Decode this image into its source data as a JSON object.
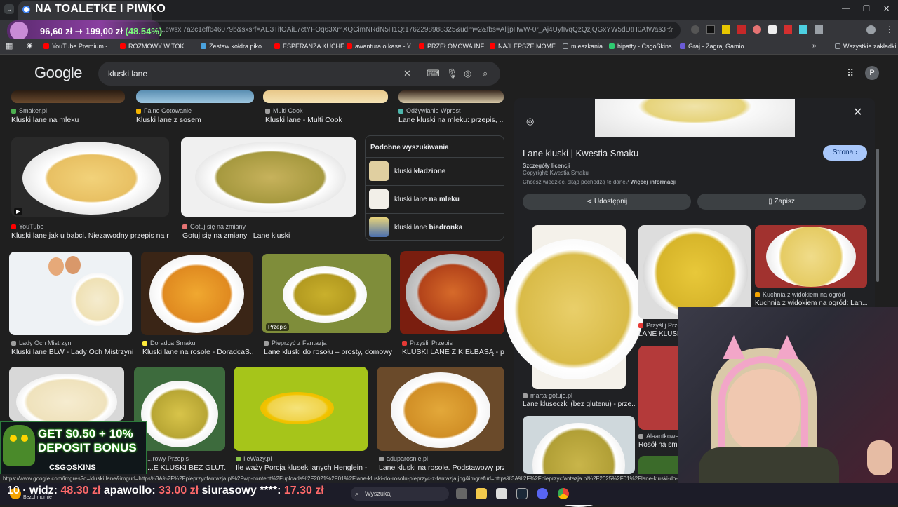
{
  "overlay": {
    "stream_title": "NA TOALETKE I PIWKO",
    "donation_amount": "96,60 zł ➝ 199,00 zł",
    "donation_pct": "(48.54%)"
  },
  "browser": {
    "url": "..ewsxl7a2c1eff646079b&sxsrf=AE3TifOAiL7ctYFOq63XmXQCimNRdN5H1Q:1762298988325&udm=2&fbs=AlljpHwW-0r_Aj4UyfIvqQzQzjQGxYW5dDtH0AfWas3lK4rdHx1nh...",
    "bookmarks": [
      {
        "label": "YouTube Premium -...",
        "color": "#ff0000"
      },
      {
        "label": "ROZMOWY W TOK...",
        "color": "#ff0000"
      },
      {
        "label": "Zestaw kołdra piko...",
        "color": "#4aa3df"
      },
      {
        "label": "ESPERANZA KUCHE...",
        "color": "#ff0000"
      },
      {
        "label": "awantura o kase - Y...",
        "color": "#ff0000"
      },
      {
        "label": "PRZEŁOMOWA INF...",
        "color": "#ff0000"
      },
      {
        "label": "NAJLEPSZE MOME...",
        "color": "#ff0000"
      },
      {
        "label": "mieszkania",
        "color": "#9aa0a6"
      },
      {
        "label": "hipatty - CsgoSkins...",
        "color": "#2ecc71"
      },
      {
        "label": "Graj - Zagraj Gamio...",
        "color": "#6b5bd6"
      },
      {
        "label": "Wszystkie zakładki",
        "color": "#9aa0a6"
      }
    ],
    "status_url": "https://www.google.com/imgres?q=kluski lane&imgurl=https%3A%2F%2Fpieprzycfantazja.pl%2Fwp-content%2Fuploads%2F2021%2F01%2Flane-kluski-do-rosolu-pieprzyc-z-fantazja.jpg&imgrefurl=https%3A%2F%2Fpieprzycfantazja.pl%2F2025%2F01%2Flane-kluski-do-ro"
  },
  "google": {
    "logo": "Google",
    "query": "kluski lane",
    "avatar": "P"
  },
  "results_top": [
    {
      "source": "Smaker.pl",
      "title": "Kluski lane na mleku",
      "fav": "#4caf50"
    },
    {
      "source": "Fajne Gotowanie",
      "title": "Kluski lane z sosem",
      "fav": "#f4b400"
    },
    {
      "source": "Multi Cook",
      "title": "Kluski lane - Multi Cook",
      "fav": "#9e9e9e"
    },
    {
      "source": "Odżywianie Wprost",
      "title": "Lane kluski na mleku: przepis, ...",
      "fav": "#4db6ac"
    }
  ],
  "results_row2": [
    {
      "source": "YouTube",
      "title": "Kluski lane jak u babci. Niezawodny przepis na mi...",
      "fav": "#ff0000"
    },
    {
      "source": "Gotuj się na zmiany",
      "title": "Gotuj się na zmiany | Lane kluski",
      "fav": "#e57373"
    }
  ],
  "related": {
    "title": "Podobne wyszukiwania",
    "items": [
      {
        "prefix": "kluski ",
        "bold": "kładzione"
      },
      {
        "prefix": "kluski lane ",
        "bold": "na mleku"
      },
      {
        "prefix": "kluski lane ",
        "bold": "biedronka"
      }
    ]
  },
  "results_row3": [
    {
      "source": "Lady Och Mistrzyni",
      "title": "Kluski lane BLW - Lady Och Mistrzyni",
      "fav": "#9e9e9e"
    },
    {
      "source": "Doradca Smaku",
      "title": "Kluski lane na rosole - DoradcaS...",
      "fav": "#ffeb3b"
    },
    {
      "source": "Pieprzyć z Fantazją",
      "title": "Lane kluski do rosołu – prosty, domowy...",
      "fav": "#9e9e9e",
      "badge": "Przepis"
    },
    {
      "source": "Przyślij Przepis",
      "title": "KLUSKI LANE Z KIEŁBASĄ - p...",
      "fav": "#e53935"
    }
  ],
  "results_row4": [
    {
      "source": "...rowy Przepis",
      "title": "...E KLUSKI BEZ GLUT...",
      "fav": "#9e9e9e"
    },
    {
      "source": "IleWazy.pl",
      "title": "Ile waży Porcja klusek lanych Henglein - ...",
      "fav": "#8bc34a"
    },
    {
      "source": "aduparosnie.pl",
      "title": "Lane kluski na rosole. Podstawowy prz...",
      "fav": "#9e9e9e"
    }
  ],
  "panel": {
    "title": "Lane kluski | Kwestia Smaku",
    "visit": "Strona ›",
    "license": "Szczegóły licencji",
    "copyright": "Copyright: Kwestia Smaku",
    "origin_q": "Chcesz wiedzieć, skąd pochodzą te dane?",
    "origin_link": "Więcej informacji",
    "share": "Udostępnij",
    "save": "Zapisz",
    "related": [
      {
        "source": "marta-gotuje.pl",
        "title": "Lane kluseczki (bez glutenu) - prze..."
      },
      {
        "source": "Kuchnia z widokiem na ogród",
        "title": "Kuchnia z widokiem na ogród: Lan..."
      },
      {
        "source": "Przyślij Prze...",
        "title": "LANE KLUSK..."
      },
      {
        "source": "Alaantkowe...",
        "title": "Rosół na sma..."
      }
    ]
  },
  "ad": {
    "line1": "GET $0.50 + 10%",
    "line2": "DEPOSIT BONUS",
    "brand": "CSG⊙SKINS"
  },
  "ticker": {
    "p1": "10 · widz:",
    "a1": "48.30 zł",
    "p2": "apawollo:",
    "a2": "33.00 zł",
    "p3": "siurasowy ****:",
    "a3": "17.30 zł"
  },
  "taskbar": {
    "search": "Wyszukaj",
    "user": "Bezchmurnie"
  }
}
